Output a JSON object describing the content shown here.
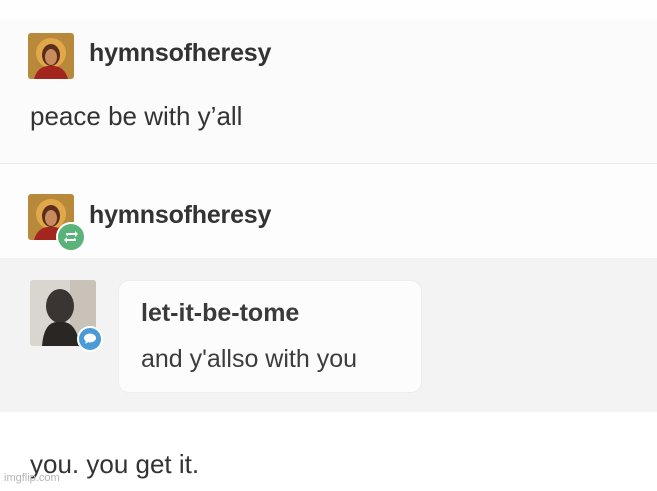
{
  "post1": {
    "username": "hymnsofheresy",
    "body": "peace be with y’all"
  },
  "post2": {
    "username": "hymnsofheresy",
    "badge_icon": "reblog-icon"
  },
  "reply": {
    "username": "let-it-be-tome",
    "body": "and y'allso with you",
    "badge_icon": "speech-bubble-icon"
  },
  "post2_body": "you. you get it.",
  "watermark": "imgflip.com",
  "colors": {
    "reblog": "#5ab47a",
    "reply": "#4a9ad8"
  }
}
